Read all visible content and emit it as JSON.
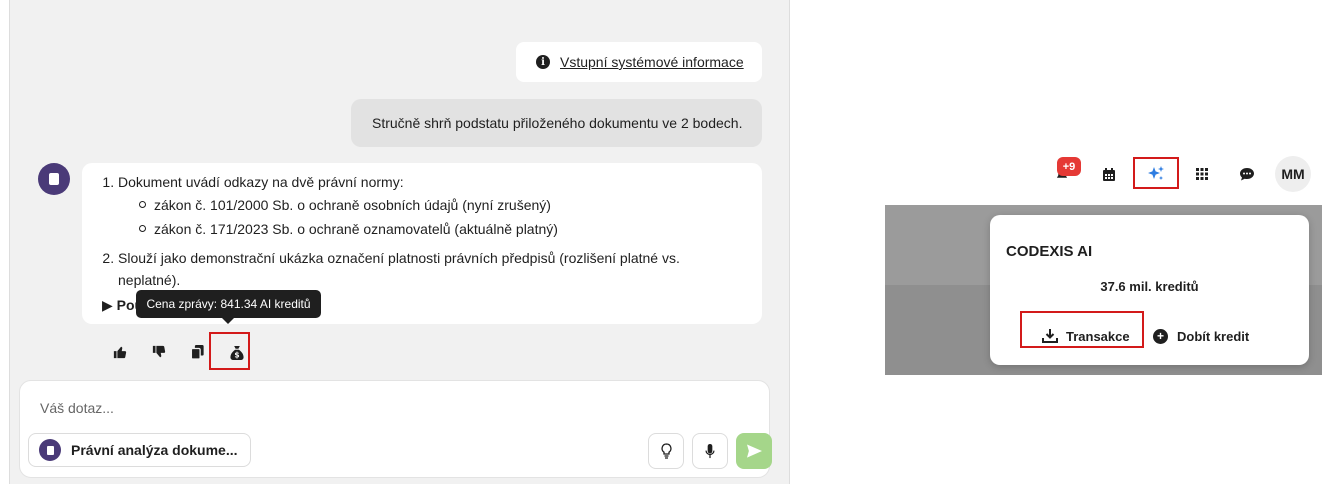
{
  "chat": {
    "system_info_link": "Vstupní systémové informace",
    "user_message": "Stručně shrň podstatu přiloženého dokumentu ve 2 bodech.",
    "bot_message": {
      "item1": "Dokument uvádí odkazy na dvě právní normy:",
      "sub1": "zákon č. 101/2000 Sb. o ochraně osobních údajů (nyní zrušený)",
      "sub2": "zákon č. 171/2023 Sb. o ochraně oznamovatelů (aktuálně platný)",
      "item2": "Slouží jako demonstrační ukázka označení platnosti právních předpisů (rozlišení platné vs. neplatné).",
      "details_label": "Pou"
    },
    "tooltip": "Cena zprávy: 841.34 AI kreditů",
    "actions": [
      "thumbs-up-icon",
      "thumbs-down-icon",
      "copy-icon",
      "money-bag-icon"
    ]
  },
  "composer": {
    "placeholder": "Váš dotaz...",
    "agent_label": "Právní analýza dokume..."
  },
  "topbar": {
    "notification_badge": "+9",
    "avatar_initials": "MM"
  },
  "ai_dropdown": {
    "title": "CODEXIS AI",
    "credits": "37.6 mil. kreditů",
    "transactions_label": "Transakce",
    "topup_label": "Dobít kredit"
  },
  "colors": {
    "highlight": "#d31a1a",
    "send_button": "#a5d68a",
    "badge": "#e53935",
    "ai_icon": "#2f7de1"
  }
}
